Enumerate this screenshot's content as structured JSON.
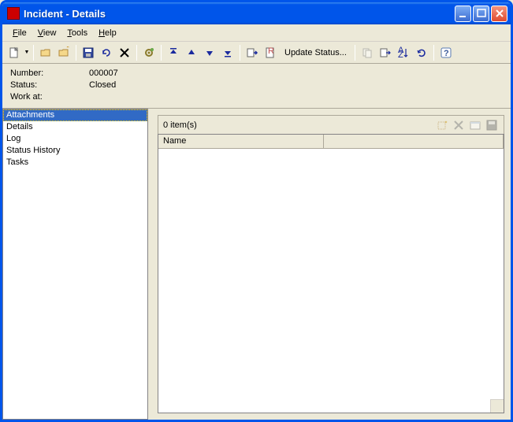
{
  "window": {
    "title": "Incident - Details"
  },
  "menu": {
    "file": "File",
    "view": "View",
    "tools": "Tools",
    "help": "Help"
  },
  "toolbar": {
    "update_status": "Update Status..."
  },
  "info": {
    "number_label": "Number:",
    "number_value": "000007",
    "status_label": "Status:",
    "status_value": "Closed",
    "workat_label": "Work at:",
    "workat_value": ""
  },
  "sidebar": {
    "items": [
      {
        "label": "Attachments",
        "selected": true
      },
      {
        "label": "Details",
        "selected": false
      },
      {
        "label": "Log",
        "selected": false
      },
      {
        "label": "Status History",
        "selected": false
      },
      {
        "label": "Tasks",
        "selected": false
      }
    ]
  },
  "content": {
    "item_count": "0 item(s)",
    "columns": {
      "name": "Name"
    }
  }
}
